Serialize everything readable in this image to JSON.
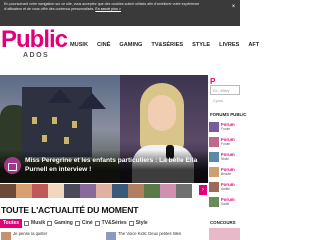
{
  "cookie_banner": {
    "text": "En poursuivant votre navigation sur ce site, vous acceptez que des cookies soient utilisés afin d'améliorer votre expérience d'utilisateur et de vous offrir des contenus personnalisés.",
    "more_link": "En savoir plus >",
    "close": "×"
  },
  "logo": {
    "main": "Public",
    "sub": "ADOS"
  },
  "nav": {
    "items": [
      "MUSIK",
      "CINÉ",
      "GAMING",
      "TV&SÉRIES",
      "STYLE",
      "LIVRES",
      "AFT"
    ]
  },
  "hero": {
    "title": "Miss Peregrine et les enfants particuliers : La belle Ella Purnell en interview !",
    "icon": "camera-icon"
  },
  "sidebar": {
    "logo": "P",
    "search_placeholder": "Ex : Miley Cyrus",
    "forums_title": "FORUMS PUBLIC",
    "forums": [
      {
        "name": "Forum",
        "desc": "Forum"
      },
      {
        "name": "Forum",
        "desc": "Forum"
      },
      {
        "name": "Forum",
        "desc": "Mode"
      },
      {
        "name": "Forum",
        "desc": "Beauté"
      },
      {
        "name": "Forum",
        "desc": "Amitié"
      },
      {
        "name": "Forum",
        "desc": "Santé"
      }
    ],
    "concours_title": "CONCOURS"
  },
  "strip": {
    "next": "›"
  },
  "actu": {
    "title": "TOUTE L'ACTUALITÉ DU MOMENT",
    "tabs": [
      "Toutes",
      "Musik",
      "Gaming",
      "Ciné",
      "TV&Séries",
      "Style"
    ],
    "articles": [
      {
        "text": "Je pense la quitter"
      },
      {
        "text": "The Voice Kids: Deux petites filles"
      }
    ]
  },
  "colors": {
    "brand": "#e2007a",
    "cookie_bg": "#3a3a3a"
  }
}
